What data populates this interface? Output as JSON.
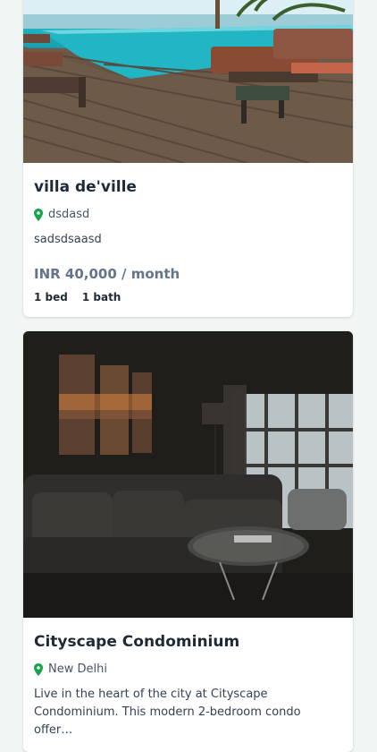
{
  "listings": [
    {
      "title": "villa de'ville",
      "location": "dsdasd",
      "description": "sadsdsaasd",
      "price": "INR 40,000 / month",
      "beds": "1 bed",
      "baths": "1 bath",
      "image": "pool-deck-photo"
    },
    {
      "title": "Cityscape Condominium",
      "location": "New Delhi",
      "description": "Live in the heart of the city at Cityscape Condominium. This modern 2-bedroom condo offer…",
      "image": "living-room-photo"
    }
  ],
  "colors": {
    "pin": "#16a34a",
    "price": "#64748b",
    "page_bg": "#f1f5f3"
  }
}
